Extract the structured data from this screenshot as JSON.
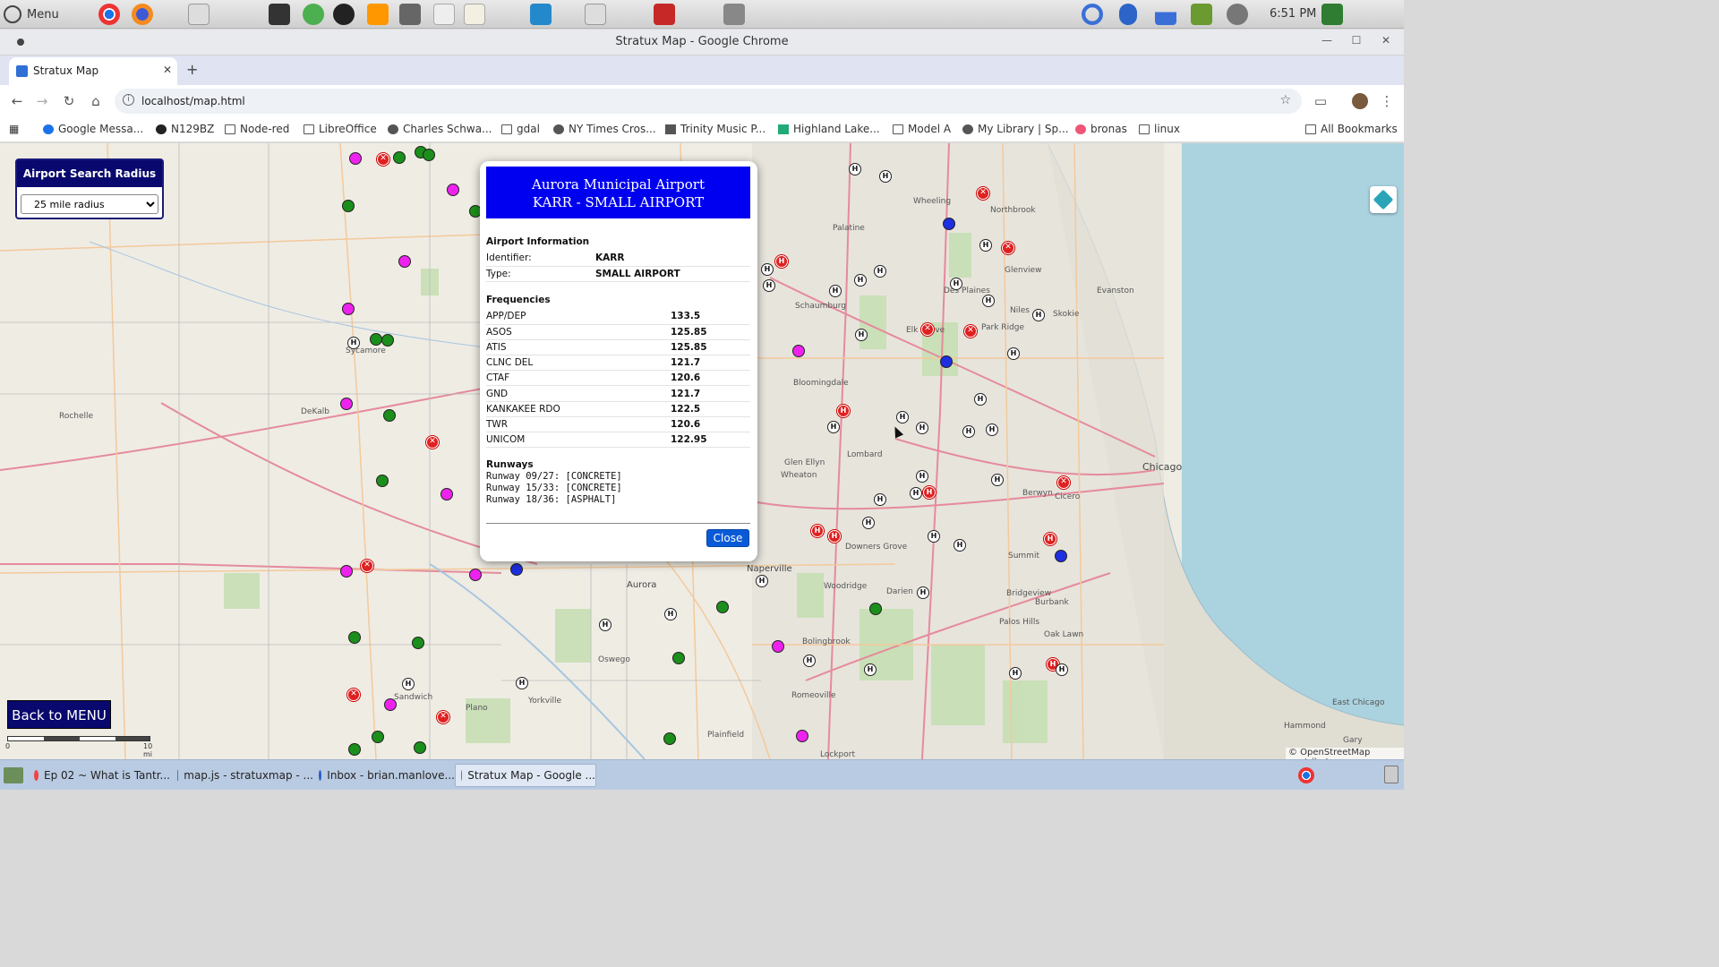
{
  "os": {
    "menu_label": "Menu",
    "clock": "6:51 PM",
    "launchers": [
      "chrome-icon",
      "firefox-icon",
      "text-editor-icon",
      "terminal-icon",
      "maps-icon",
      "vivaldi-icon",
      "sublime-icon",
      "calculator-icon",
      "notes-icon",
      "editor-icon",
      "vscode-icon",
      "word-icon",
      "gitkraken-icon",
      "screenshot-icon"
    ]
  },
  "window": {
    "title": "Stratux Map - Google Chrome"
  },
  "tab": {
    "label": "Stratux Map"
  },
  "address": {
    "url": "localhost/map.html"
  },
  "bookmarks": {
    "items": [
      "Google Messa...",
      "N129BZ",
      "Node-red",
      "LibreOffice",
      "Charles Schwa...",
      "gdal",
      "NY Times Cros...",
      "Trinity Music P...",
      "Highland Lake...",
      "Model A",
      "My Library | Sp...",
      "bronas",
      "linux"
    ],
    "all": "All Bookmarks"
  },
  "radius_panel": {
    "title": "Airport Search Radius",
    "selected": "25 mile radius"
  },
  "back_menu": "Back to MENU",
  "attribution": "© OpenStreetMap contributors.",
  "scale": {
    "left": "0",
    "right": "10 mi"
  },
  "popup": {
    "name": "Aurora Municipal Airport",
    "subtitle": "KARR - SMALL AIRPORT",
    "info_heading": "Airport Information",
    "info": [
      {
        "label": "Identifier:",
        "value": "KARR"
      },
      {
        "label": "Type:",
        "value": "SMALL AIRPORT"
      }
    ],
    "freq_heading": "Frequencies",
    "frequencies": [
      {
        "label": "APP/DEP",
        "value": "133.5"
      },
      {
        "label": "ASOS",
        "value": "125.85"
      },
      {
        "label": "ATIS",
        "value": "125.85"
      },
      {
        "label": "CLNC DEL",
        "value": "121.7"
      },
      {
        "label": "CTAF",
        "value": "120.6"
      },
      {
        "label": "GND",
        "value": "121.7"
      },
      {
        "label": "KANKAKEE RDO",
        "value": "122.5"
      },
      {
        "label": "TWR",
        "value": "120.6"
      },
      {
        "label": "UNICOM",
        "value": "122.95"
      }
    ],
    "runways_heading": "Runways",
    "runways": [
      "Runway 09/27: [CONCRETE]",
      "Runway 15/33: [CONCRETE]",
      "Runway 18/36: [ASPHALT]"
    ],
    "close_label": "Close"
  },
  "map_labels": {
    "cities": [
      "Aurora",
      "Naperville",
      "Chicago",
      "Evanston",
      "Rochelle",
      "DeKalb",
      "Sycamore",
      "Schaumburg",
      "Bloomingdale",
      "Wheaton",
      "Lombard",
      "Oswego",
      "Plano",
      "Sandwich",
      "Yorkville",
      "Woodridge",
      "Bolingbrook",
      "Romeoville",
      "Darien",
      "Hammond",
      "Glen Ellyn",
      "Elk Grove",
      "Park Ridge",
      "Des Plaines",
      "Skokie",
      "Niles",
      "Wheeling",
      "Palatine",
      "Glenview",
      "Northbrook",
      "Cicero",
      "Berwyn",
      "Oak Lawn",
      "Burbank",
      "Summit",
      "Bridgeview",
      "Palos Hills",
      "Lockport",
      "Plainfield",
      "Downers Grove",
      "Gary",
      "East Chicago"
    ]
  },
  "taskbar": {
    "items": [
      "Ep 02 ~ What is Tantr...",
      "map.js - stratuxmap - ...",
      "Inbox - brian.manlove...",
      "Stratux Map - Google ..."
    ]
  }
}
